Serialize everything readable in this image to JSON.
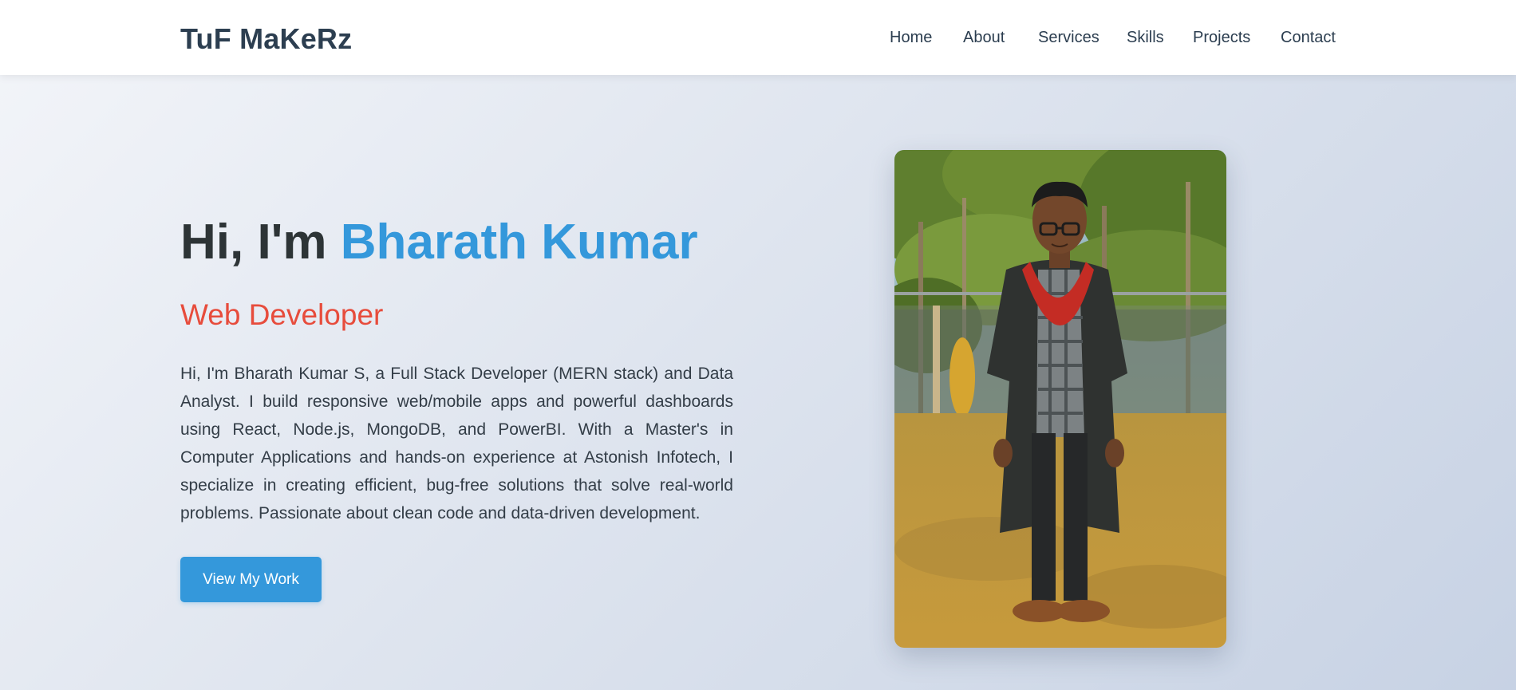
{
  "brand": {
    "logo_text": "TuF MaKeRz"
  },
  "nav": {
    "items": [
      {
        "label": "Home"
      },
      {
        "label": "About"
      },
      {
        "label": "Services"
      },
      {
        "label": "Skills"
      },
      {
        "label": "Projects"
      },
      {
        "label": "Contact"
      }
    ]
  },
  "hero": {
    "greeting": "Hi, I'm ",
    "name": "Bharath Kumar",
    "role": "Web Developer",
    "bio": "Hi, I'm Bharath Kumar S, a Full Stack Developer (MERN stack) and Data Analyst. I build responsive web/mobile apps and powerful dashboards using React, Node.js, MongoDB, and PowerBI. With a Master's in Computer Applications and hands-on experience at Astonish Infotech, I specialize in creating efficient, bug-free solutions that solve real-world problems. Passionate about clean code and data-driven development.",
    "cta_label": "View My Work"
  },
  "colors": {
    "accent": "#3498db",
    "role_red": "#e74c3c",
    "text_dark": "#2c3e50"
  },
  "portrait": {
    "icon": "graduate-portrait-illustration"
  }
}
